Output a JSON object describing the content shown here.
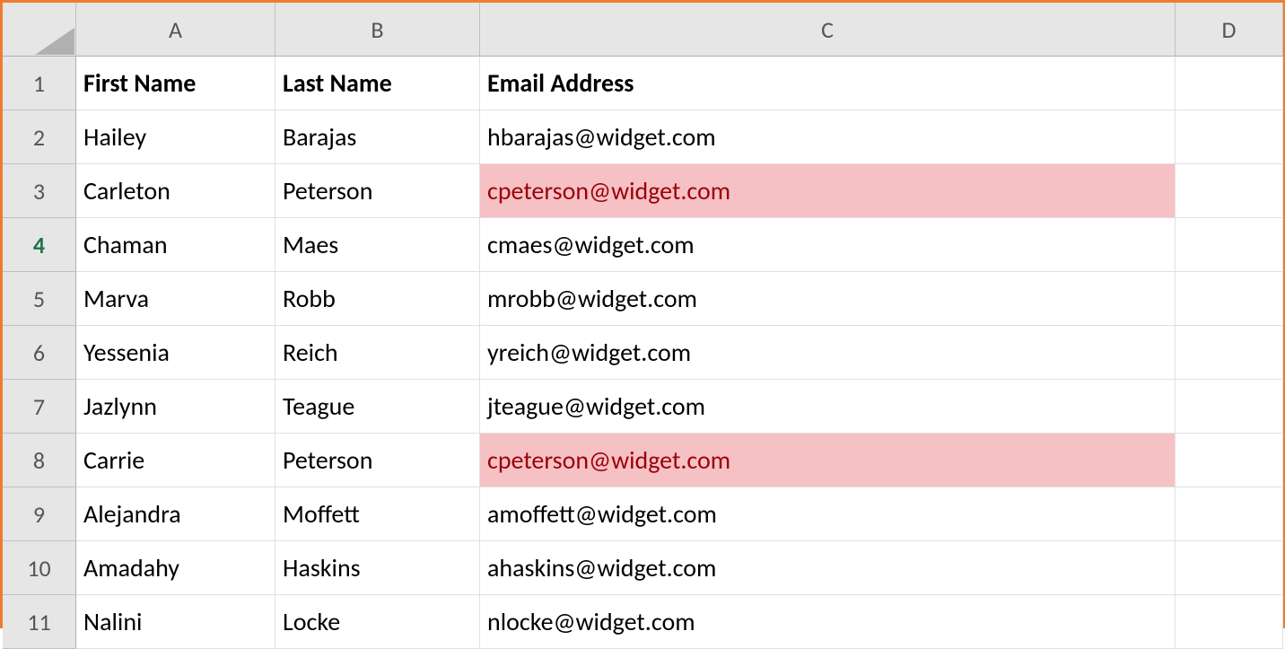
{
  "columns": [
    "A",
    "B",
    "C",
    "D"
  ],
  "active_row": 4,
  "sheet": {
    "headers": [
      "First Name",
      "Last Name",
      "Email Address"
    ],
    "rows": [
      {
        "first": "Hailey",
        "last": "Barajas",
        "email": "hbarajas@widget.com",
        "highlight": false
      },
      {
        "first": "Carleton",
        "last": "Peterson",
        "email": "cpeterson@widget.com",
        "highlight": true
      },
      {
        "first": "Chaman",
        "last": "Maes",
        "email": "cmaes@widget.com",
        "highlight": false
      },
      {
        "first": "Marva",
        "last": "Robb",
        "email": "mrobb@widget.com",
        "highlight": false
      },
      {
        "first": "Yessenia",
        "last": "Reich",
        "email": "yreich@widget.com",
        "highlight": false
      },
      {
        "first": "Jazlynn",
        "last": "Teague",
        "email": "jteague@widget.com",
        "highlight": false
      },
      {
        "first": "Carrie",
        "last": "Peterson",
        "email": "cpeterson@widget.com",
        "highlight": true
      },
      {
        "first": "Alejandra",
        "last": "Moffett",
        "email": "amoffett@widget.com",
        "highlight": false
      },
      {
        "first": "Amadahy",
        "last": "Haskins",
        "email": "ahaskins@widget.com",
        "highlight": false
      },
      {
        "first": "Nalini",
        "last": "Locke",
        "email": "nlocke@widget.com",
        "highlight": false
      }
    ]
  }
}
